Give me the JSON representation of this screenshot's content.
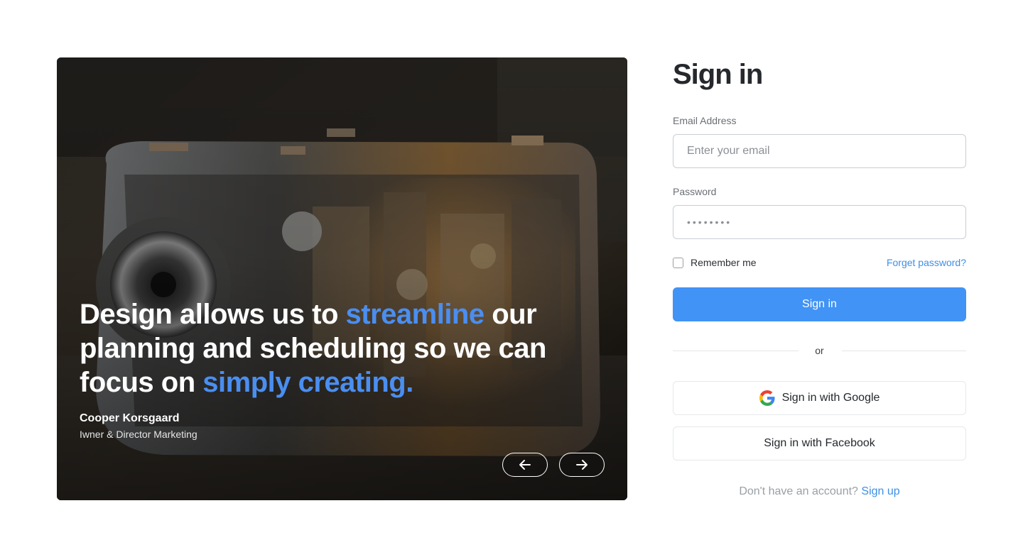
{
  "hero": {
    "quote_part1": "Design allows us to ",
    "quote_accent1": "streamline",
    "quote_part2": " our planning and scheduling so we can focus on ",
    "quote_accent2": "simply creating.",
    "author_name": "Cooper Korsgaard",
    "author_role": "Iwner & Director Marketing",
    "prev_icon": "arrow-left-icon",
    "next_icon": "arrow-right-icon",
    "accent_color": "#4a8ef0"
  },
  "form": {
    "title": "Sign in",
    "email": {
      "label": "Email Address",
      "placeholder": "Enter your email",
      "value": ""
    },
    "password": {
      "label": "Password",
      "value": "••••••••"
    },
    "remember_label": "Remember me",
    "remember_checked": false,
    "forgot_label": "Forget password?",
    "submit_label": "Sign in",
    "divider_label": "or",
    "google_label": "Sign in with Google",
    "facebook_label": "Sign in with Facebook",
    "signup_prompt": "Don't have an account?",
    "signup_link": "Sign up",
    "primary_color": "#4193f5",
    "link_color": "#3d8fe6"
  }
}
